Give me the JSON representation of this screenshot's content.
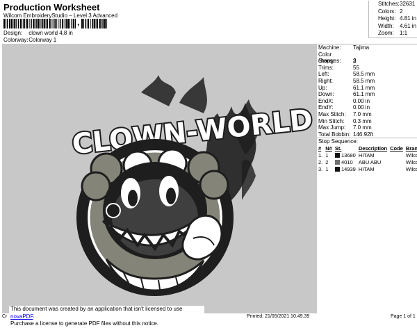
{
  "header": {
    "title": "Production Worksheet",
    "subtitle": "Wilcom EmbroideryStudio – Level 3 Advanced",
    "barcode_tick": ",",
    "design_label": "Design:",
    "design_value": "clown world 4,8 in",
    "colorway_label": "Colorway:",
    "colorway_value": "Colorway 1"
  },
  "stats": [
    {
      "label": "Stitches:",
      "value": "32631"
    },
    {
      "label": "Colors:",
      "value": "2"
    },
    {
      "label": "Height:",
      "value": "4.81 in"
    },
    {
      "label": "Width:",
      "value": "4.61 in"
    },
    {
      "label": "Zoom:",
      "value": "1:1"
    }
  ],
  "design": {
    "text": "CLOWN-WORLD",
    "colors": {
      "dark": "#1e1e1e",
      "mid": "#858478",
      "light": "#d4d4cc",
      "bg": "#c8c8c8"
    }
  },
  "machine": [
    {
      "label": "Machine:",
      "value": "Tajima"
    },
    {
      "label": "Color changes:",
      "value": "2"
    },
    {
      "label": "Stops:",
      "value": "3"
    },
    {
      "label": "Trims:",
      "value": "55"
    },
    {
      "label": "Left:",
      "value": "58.5 mm"
    },
    {
      "label": "Right:",
      "value": "58.5 mm"
    },
    {
      "label": "Up:",
      "value": "61.1 mm"
    },
    {
      "label": "Down:",
      "value": "61.1 mm"
    },
    {
      "label": "EndX:",
      "value": "0.00 in"
    },
    {
      "label": "EndY:",
      "value": "0.00 in"
    },
    {
      "label": "Max Stitch:",
      "value": "7.0 mm"
    },
    {
      "label": "Min Stitch:",
      "value": "0.3 mm"
    },
    {
      "label": "Max Jump:",
      "value": "7.0 mm"
    },
    {
      "label": "Total Bobbin:",
      "value": "146.92ft"
    }
  ],
  "stop_sequence": {
    "title": "Stop Sequence:",
    "columns": [
      "#",
      "N#",
      "St.",
      "Description",
      "Code",
      "Brand"
    ],
    "rows": [
      {
        "num": "1.",
        "n": "1",
        "color": "#111111",
        "st": "13680",
        "desc": "HITAM",
        "code": "",
        "brand": "Wilcom"
      },
      {
        "num": "2.",
        "n": "2",
        "color": "#6e6e6e",
        "st": "4010",
        "desc": "ABU ABU",
        "code": "",
        "brand": "Wilcom"
      },
      {
        "num": "3.",
        "n": "1",
        "color": "#111111",
        "st": "14939",
        "desc": "HITAM",
        "code": "",
        "brand": "Wilcom"
      }
    ]
  },
  "notice": {
    "line1": "This document was created by an application that isn't licensed to use ",
    "link": "novaPDF",
    "line1_end": ".",
    "line2": "Purchase a license to generate PDF files without this notice."
  },
  "footer": {
    "left": "Cr",
    "printed": "Printed: 21/05/2021 10.49.39",
    "page": "Page 1 of 1"
  }
}
